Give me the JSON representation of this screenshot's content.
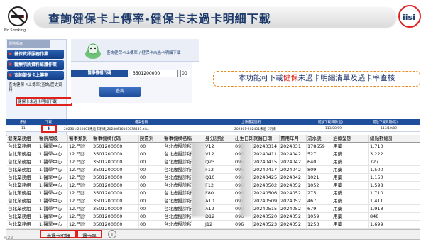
{
  "slide": {
    "title": "查詢健保卡上傳率-健保卡未過卡明細下載",
    "no_smoking_text": "No Smoking",
    "page_number": "P.28"
  },
  "portal": {
    "sidebar_header": "服務項目",
    "menu": [
      "健保資訊服務作業",
      "醫療院所資料維護作業",
      "查詢健保卡上傳率"
    ],
    "sub_items": [
      "查詢健保卡上傳率(查詢/歷史資料",
      "健保卡未過卡明細下載"
    ],
    "breadcrumb": "查詢健保卡上傳率 / 健保卡未過卡明細下載",
    "form_label": "醫事機構代碼",
    "form_value": "3501200000",
    "form_value_suffix": "00",
    "query_button": "查詢"
  },
  "callout": {
    "prefix": "本功能可下載",
    "highlight": "健保",
    "suffix": "未過卡明細清單及過卡率查核"
  },
  "download_table": {
    "headers": [
      "序號",
      "下載",
      "檔案名稱",
      "上傳檔案說明",
      "開放下載日期(起)",
      "開放下載日期(迄)"
    ],
    "row": [
      "11",
      "",
      "202301-202401未過卡明細_20240816165638437.xlsx",
      "202301-202401未過卡明細",
      "113/08/09",
      "113/10/09"
    ]
  },
  "sheet": {
    "headers": [
      "健保業務組",
      "醫院層級",
      "醫事類別",
      "醫事機構代碼",
      "院區別",
      "醫事機構名稱",
      "身分證號",
      "出生日期",
      "就醫日期",
      "費用年月",
      "流水號",
      "治療型態",
      "總點數總計"
    ],
    "rows": [
      [
        "台北業務組",
        "1.醫學中心",
        "12.門診",
        "3501200000",
        "00",
        "台北虛擬診所",
        "V12",
        "095",
        "20240314",
        "2024031",
        "178659",
        "用藥",
        "1,710"
      ],
      [
        "台北業務組",
        "1.醫學中心",
        "12.門診",
        "3501200000",
        "00",
        "台北虛擬診所",
        "V12",
        "095",
        "20240411",
        "2024042",
        "527",
        "用藥",
        "3,222"
      ],
      [
        "台北業務組",
        "1.醫學中心",
        "12.門診",
        "3501200000",
        "00",
        "台北虛擬診所",
        "Q23",
        "096",
        "20240415",
        "2024042",
        "640",
        "用藥",
        "727"
      ],
      [
        "台北業務組",
        "1.醫學中心",
        "12.門診",
        "3501200000",
        "00",
        "台北虛擬診所",
        "F12",
        "096",
        "20240417",
        "2024042",
        "809",
        "用藥",
        "1,500"
      ],
      [
        "台北業務組",
        "1.醫學中心",
        "12.門診",
        "3501200000",
        "00",
        "台北虛擬診所",
        "Q10",
        "098",
        "20240425",
        "2024042",
        "1021",
        "用藥",
        "1,150"
      ],
      [
        "台北業務組",
        "1.醫學中心",
        "12.門診",
        "3501200000",
        "00",
        "台北虛擬診所",
        "F12",
        "096",
        "20240502",
        "2024052",
        "1052",
        "用藥",
        "1,598"
      ],
      [
        "台北業務組",
        "1.醫學中心",
        "12.門診",
        "3501200000",
        "00",
        "台北虛擬診所",
        "F80",
        "096",
        "20240506",
        "2024052",
        "275",
        "用藥",
        "1,710"
      ],
      [
        "台北業務組",
        "1.醫學中心",
        "12.門診",
        "3501200000",
        "00",
        "台北虛擬診所",
        "A10",
        "097",
        "20240509",
        "2024052",
        "467",
        "用藥",
        "1,411"
      ],
      [
        "台北業務組",
        "1.醫學中心",
        "12.門診",
        "3501200000",
        "00",
        "台北虛擬診所",
        "A12",
        "093",
        "20240515",
        "2024052",
        "679",
        "用藥",
        "1,918"
      ],
      [
        "台北業務組",
        "1.醫學中心",
        "12.門診",
        "3501200000",
        "00",
        "台北虛擬診所",
        "D12",
        "096",
        "20240520",
        "2024052",
        "1059",
        "用藥",
        "848"
      ],
      [
        "台北業務組",
        "1.醫學中心",
        "12.門診",
        "3501200000",
        "00",
        "台北虛擬診所",
        "J12",
        "096",
        "20240523",
        "2024052",
        "1253",
        "用藥",
        "1,699"
      ]
    ],
    "tabs": [
      "未過卡明細",
      "過卡率"
    ],
    "add_tab": "+"
  },
  "colors": {
    "accent": "#1f4e9a",
    "highlight": "#e0201a",
    "callout_border": "#f08a1c"
  }
}
